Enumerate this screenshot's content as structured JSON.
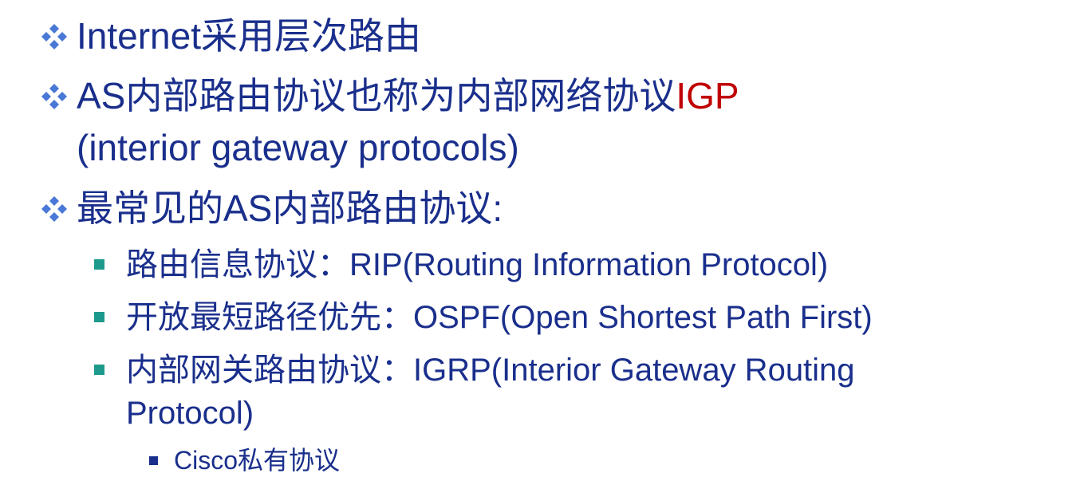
{
  "bullets": [
    {
      "parts": [
        {
          "text": "Internet采用层次路由",
          "accent": false
        }
      ]
    },
    {
      "parts": [
        {
          "text": "AS内部路由协议也称为内部网络协议",
          "accent": false
        },
        {
          "text": "IGP",
          "accent": true
        }
      ],
      "continuation": "(interior gateway protocols)"
    },
    {
      "parts": [
        {
          "text": "最常见的AS内部路由协议:",
          "accent": false
        }
      ],
      "subitems": [
        {
          "text": "路由信息协议：RIP(Routing Information Protocol)"
        },
        {
          "text": "开放最短路径优先：OSPF(Open Shortest Path First)"
        },
        {
          "text": "内部网关路由协议：IGRP(Interior Gateway Routing",
          "continuation": "Protocol)",
          "subitems": [
            {
              "text": "Cisco私有协议"
            }
          ]
        }
      ]
    }
  ],
  "colors": {
    "text": "#1a2f8c",
    "accent": "#c00000",
    "diamond_bullet": "#4a78d6",
    "square_bullet": "#1e9a8c"
  }
}
